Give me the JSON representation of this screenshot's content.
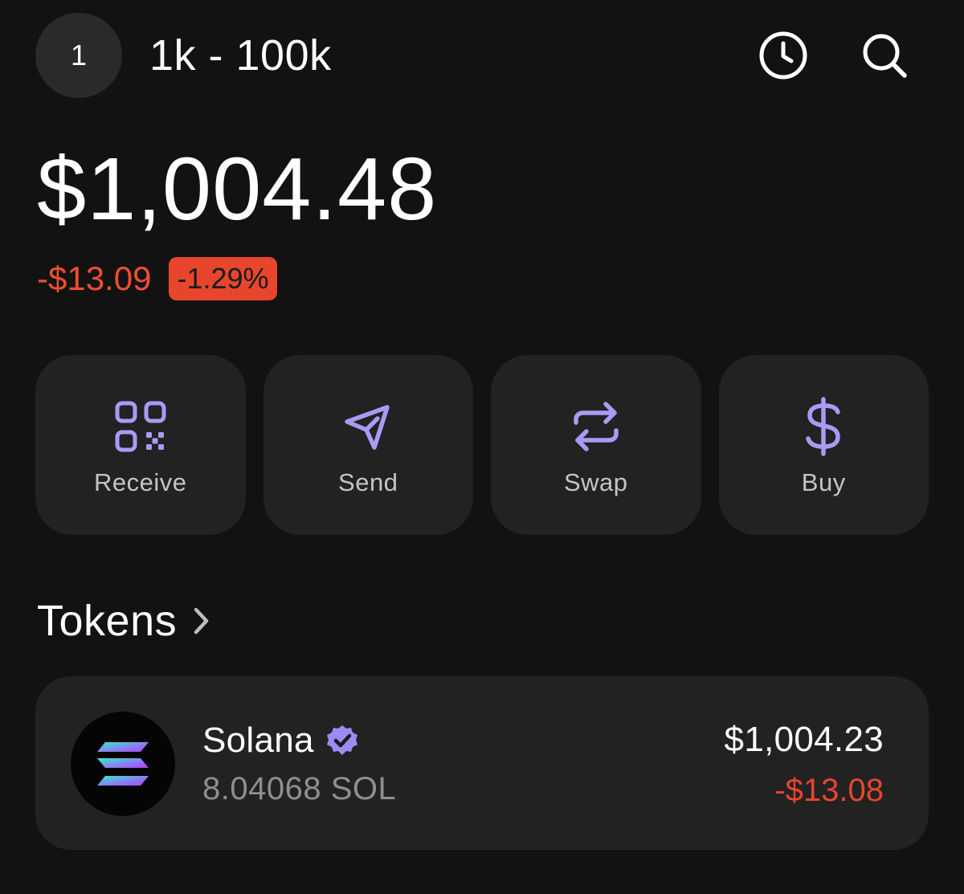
{
  "header": {
    "account_index": "1",
    "account_name": "1k - 100k",
    "icons": [
      "history-icon",
      "search-icon"
    ]
  },
  "balance": {
    "total": "$1,004.48",
    "change_amount": "-$13.09",
    "change_percent": "-1.29%"
  },
  "actions": [
    {
      "label": "Receive",
      "icon": "qr-code-icon"
    },
    {
      "label": "Send",
      "icon": "send-icon"
    },
    {
      "label": "Swap",
      "icon": "swap-icon"
    },
    {
      "label": "Buy",
      "icon": "dollar-icon"
    }
  ],
  "tokens": {
    "title": "Tokens",
    "items": [
      {
        "name": "Solana",
        "amount": "8.04068 SOL",
        "value": "$1,004.23",
        "change": "-$13.08",
        "verified": true,
        "icon": "solana-logo-icon"
      }
    ]
  },
  "colors": {
    "background": "#121212",
    "card": "#222223",
    "accent": "#a99bf5",
    "negative": "#e8462c",
    "muted": "#8e8e93"
  }
}
